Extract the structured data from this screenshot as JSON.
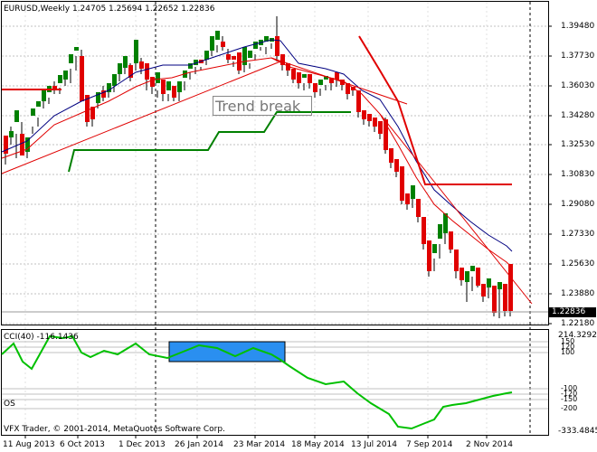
{
  "main": {
    "symbol_line": "EURUSD,Weekly  1.24705 1.25694 1.22652 1.22836",
    "annotation": "Trend break",
    "price_labels": [
      "1.39480",
      "1.37730",
      "1.36030",
      "1.34280",
      "1.32530",
      "1.30830",
      "1.29080",
      "1.27330",
      "1.25630",
      "1.23880",
      "1.22180"
    ],
    "current_price": "1.22836"
  },
  "cci": {
    "label": "CCI(40) -116.1436",
    "top_value": "214.3292",
    "bottom_value": "-333.4845",
    "levels": [
      "150",
      "120",
      "100",
      "-100",
      "-120",
      "-150",
      "-200"
    ]
  },
  "os_panel": {
    "label": "OS"
  },
  "footer": {
    "copyright": "VFX Trader, © 2001-2014, MetaQuotes Software Corp."
  },
  "time_axis": [
    "11 Aug 2013",
    "6 Oct 2013",
    "1 Dec 2013",
    "26 Jan 2014",
    "23 Mar 2014",
    "18 May 2014",
    "13 Jul 2014",
    "7 Sep 2014",
    "2 Nov 2014"
  ],
  "colors": {
    "bull": "#008000",
    "bear": "#e00000",
    "trend_red": "#e00000",
    "trend_green": "#008000",
    "ma_blue": "#000080",
    "cci_line": "#00c000",
    "highlight": "#2a8ff0"
  }
}
